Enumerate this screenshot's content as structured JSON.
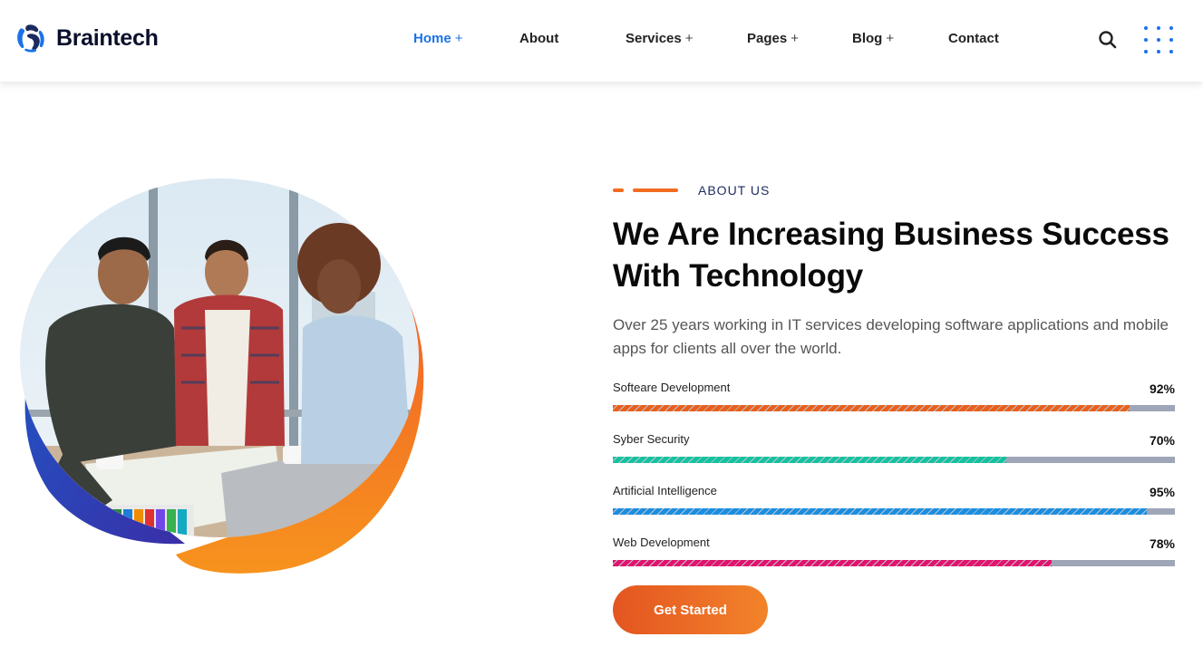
{
  "brand": {
    "name": "Braintech",
    "logo_icon": "braintech-logo-icon"
  },
  "nav": {
    "items": [
      {
        "label": "Home",
        "plus": "+",
        "active": true
      },
      {
        "label": "About",
        "plus": "",
        "active": false
      },
      {
        "label": "Services",
        "plus": "+",
        "active": false
      },
      {
        "label": "Pages",
        "plus": "+",
        "active": false
      },
      {
        "label": "Blog",
        "plus": "+",
        "active": false
      },
      {
        "label": "Contact",
        "plus": "",
        "active": false
      }
    ],
    "search_icon": "search-icon",
    "menu_icon": "dots-grid-icon"
  },
  "about": {
    "eyebrow": "ABOUT US",
    "heading_line1": "We Are Increasing Business Success",
    "heading_line2": "With Technology",
    "description": "Over 25 years working in IT services developing software applications and mobile apps for clients all over the world.",
    "skills": [
      {
        "label": "Softeare Development",
        "percent_label": "92%",
        "percent": 92,
        "color": "#e8601c"
      },
      {
        "label": "Syber Security",
        "percent_label": "70%",
        "percent": 70,
        "color": "#14c2a0"
      },
      {
        "label": "Artificial Intelligence",
        "percent_label": "95%",
        "percent": 95,
        "color": "#1a8ee0"
      },
      {
        "label": "Web Development",
        "percent_label": "78%",
        "percent": 78,
        "color": "#e0146e"
      }
    ],
    "cta_label": "Get Started"
  },
  "colors": {
    "accent": "#1a73e8",
    "brand_orange": "#f26b21",
    "heading": "#0a0a0a",
    "track": "#9fa6b8"
  }
}
